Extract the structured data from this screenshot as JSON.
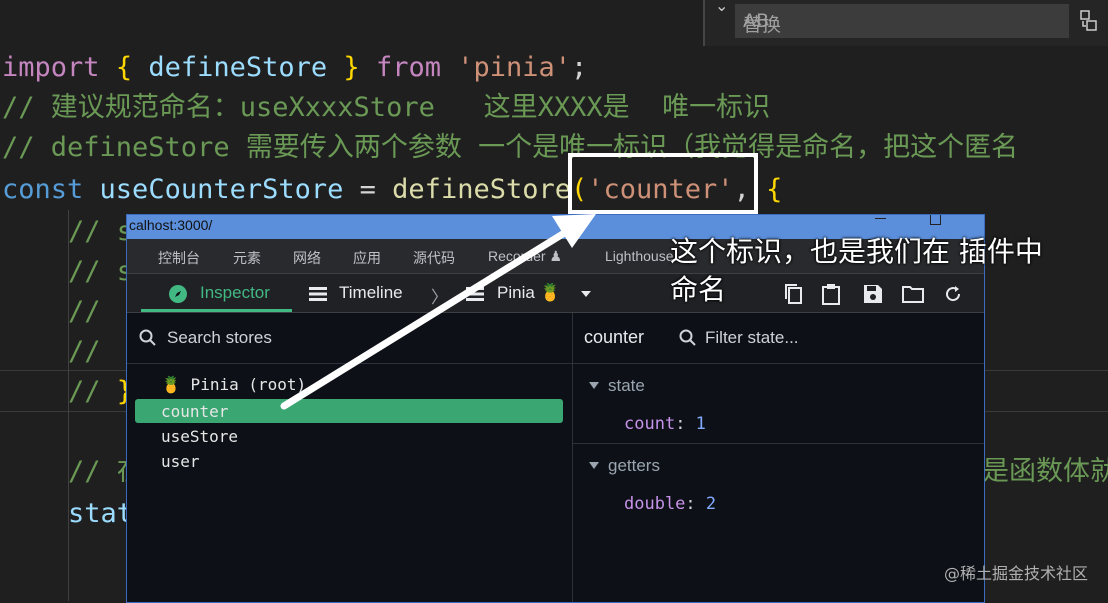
{
  "editor": {
    "line1": {
      "import": "import",
      "open": "{",
      "name": "defineStore",
      "close": "}",
      "from": "from",
      "module": "'pinia'",
      "semi": ";"
    },
    "line2": "// 建议规范命名：useXxxxStore   这里XXXX是  唯一标识",
    "line3": "// defineStore 需要传入两个参数 一个是唯一标识（我觉得是命名，把这个匿名",
    "line4": {
      "const": "const",
      "name": "useCounterStore",
      "eq": " = ",
      "fn": "defineStore",
      "paren": "(",
      "arg": "'counter'",
      "comma": ", ",
      "brace": "{"
    },
    "fragments": {
      "l5": "// s",
      "l6": "// s",
      "l7": "//",
      "l8": "//",
      "l9a": "// ",
      "l9b": "}",
      "l10": "// 在",
      "l10_right": "是函数体就",
      "l11": "stat"
    }
  },
  "find_widget": {
    "chevron": "⌄",
    "replace_placeholder": "替换",
    "preserve_case": "AB",
    "replace_all_icon": "replace-all-icon"
  },
  "devtools": {
    "url": "calhost:3000/",
    "tabs": [
      "控制台",
      "元素",
      "网络",
      "应用",
      "源代码",
      "Recorder ♟",
      "Lighthouse"
    ],
    "toolbar": {
      "inspector": "Inspector",
      "timeline": "Timeline",
      "separator": "〉",
      "pinia": "Pinia 🍍"
    },
    "search_placeholder": "Search stores",
    "stores": {
      "root": "🍍 Pinia (root)",
      "items": [
        "counter",
        "useStore",
        "user"
      ]
    },
    "selected_store": "counter",
    "filter_placeholder": "Filter state...",
    "state_section": {
      "label": "state",
      "key": "count",
      "value": "1"
    },
    "getters_section": {
      "label": "getters",
      "key": "double",
      "value": "2"
    }
  },
  "annotation": {
    "line1": "这个标识，也是我们在 插件中",
    "line2": "命名"
  },
  "watermark": "@稀土掘金技术社区",
  "colors": {
    "vue_green": "#42b883",
    "accent_blue": "#5b8fdc",
    "editor_bg": "#1f1f1f"
  }
}
